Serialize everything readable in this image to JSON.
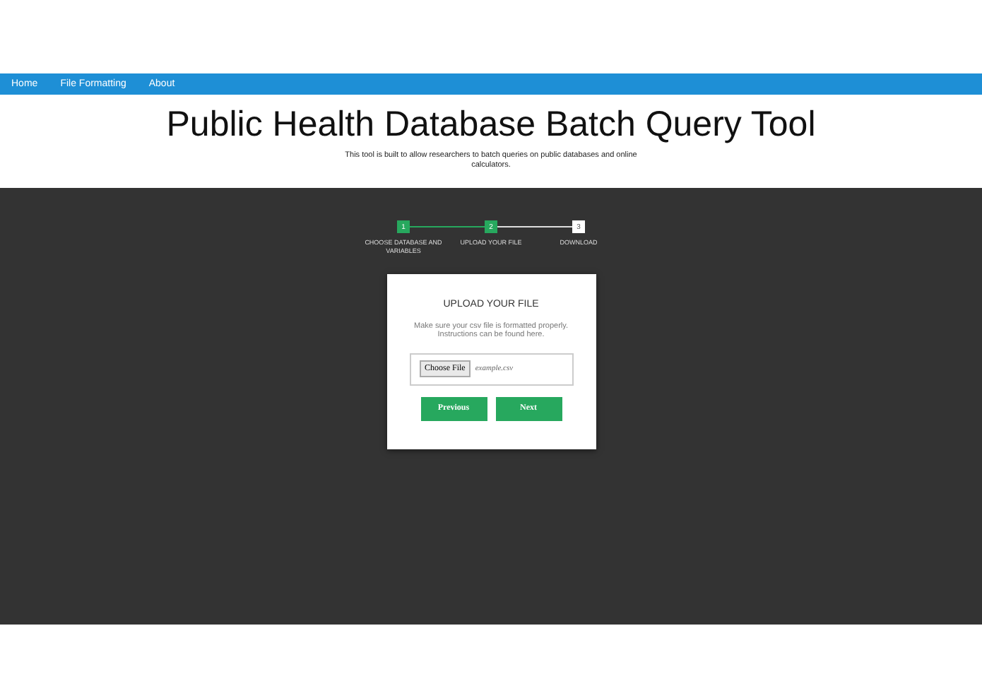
{
  "nav": [
    {
      "label": "Home"
    },
    {
      "label": "File Formatting"
    },
    {
      "label": "About"
    }
  ],
  "header": {
    "title": "Public Health Database Batch Query Tool",
    "subtitle": "This tool is built to allow researchers to batch queries on public databases and online calculators."
  },
  "steps": [
    {
      "number": "1",
      "label": "CHOOSE DATABASE AND VARIABLES",
      "done": true
    },
    {
      "number": "2",
      "label": "UPLOAD YOUR FILE",
      "done": true
    },
    {
      "number": "3",
      "label": "DOWNLOAD",
      "done": false
    }
  ],
  "card": {
    "title": "UPLOAD YOUR FILE",
    "text": "Make sure your csv file is formatted properly. Instructions can be found here.",
    "file_button": "Choose File",
    "file_name": "example.csv",
    "buttons": [
      "Previous",
      "Next"
    ]
  }
}
